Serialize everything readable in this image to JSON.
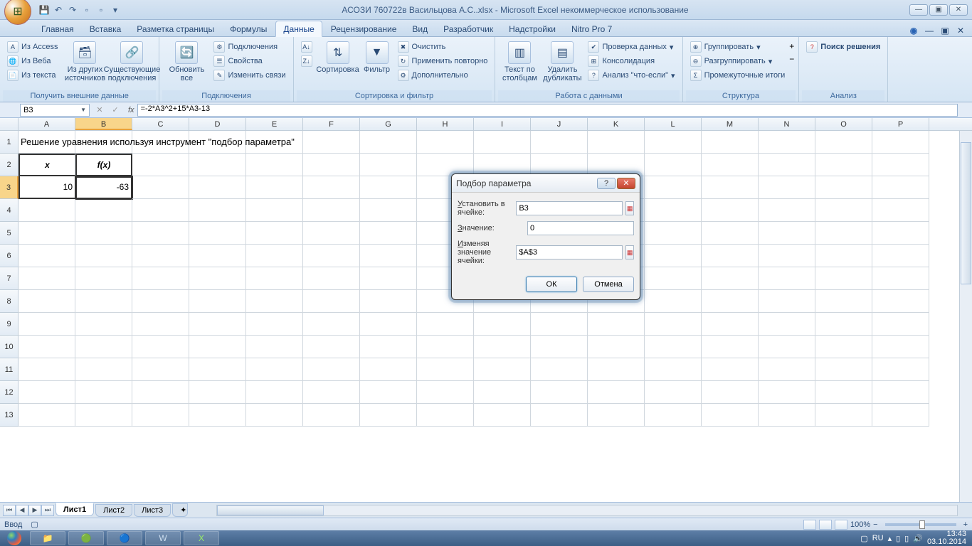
{
  "window": {
    "title": "АСОЗИ 760722в Васильцова А.С..xlsx - Microsoft Excel некоммерческое использование"
  },
  "tabs": {
    "items": [
      "Главная",
      "Вставка",
      "Разметка страницы",
      "Формулы",
      "Данные",
      "Рецензирование",
      "Вид",
      "Разработчик",
      "Надстройки",
      "Nitro Pro 7"
    ],
    "active_index": 4
  },
  "ribbon": {
    "g_ext": {
      "access": "Из Access",
      "web": "Из Веба",
      "text": "Из текста",
      "other": "Из других источников",
      "existing": "Существующие подключения",
      "label": "Получить внешние данные"
    },
    "g_conn": {
      "refresh": "Обновить все",
      "connections": "Подключения",
      "properties": "Свойства",
      "editlinks": "Изменить связи",
      "label": "Подключения"
    },
    "g_sort": {
      "sort": "Сортировка",
      "filter": "Фильтр",
      "clear": "Очистить",
      "reapply": "Применить повторно",
      "advanced": "Дополнительно",
      "label": "Сортировка и фильтр"
    },
    "g_data": {
      "ttc": "Текст по столбцам",
      "dup": "Удалить дубликаты",
      "valid": "Проверка данных",
      "consol": "Консолидация",
      "whatif": "Анализ \"что-если\"",
      "label": "Работа с данными"
    },
    "g_struct": {
      "group": "Группировать",
      "ungroup": "Разгруппировать",
      "subtotal": "Промежуточные итоги",
      "label": "Структура"
    },
    "g_analysis": {
      "solver": "Поиск решения",
      "label": "Анализ"
    }
  },
  "formula_bar": {
    "namebox": "B3",
    "fx": "fx",
    "formula": "=-2*A3^2+15*A3-13"
  },
  "grid": {
    "columns": [
      "A",
      "B",
      "C",
      "D",
      "E",
      "F",
      "G",
      "H",
      "I",
      "J",
      "K",
      "L",
      "M",
      "N",
      "O",
      "P"
    ],
    "row1_text": "Решение уравнения используя инструмент \"подбор параметра\"",
    "header_x": "x",
    "header_fx": "f(x)",
    "val_a3": "10",
    "val_b3": "-63"
  },
  "sheets": {
    "nav": [
      "⏮",
      "◀",
      "▶",
      "⏭"
    ],
    "items": [
      "Лист1",
      "Лист2",
      "Лист3"
    ],
    "active_index": 0
  },
  "statusbar": {
    "mode": "Ввод",
    "zoom": "100%"
  },
  "taskbar": {
    "lang": "RU",
    "time": "13:43",
    "date": "03.10.2014"
  },
  "dialog": {
    "title": "Подбор параметра",
    "set_cell_label": "Установить в ячейке:",
    "set_cell_value": "B3",
    "to_value_label": "Значение:",
    "to_value_value": "0",
    "by_changing_label": "Изменяя значение ячейки:",
    "by_changing_value": "$A$3",
    "ok": "ОК",
    "cancel": "Отмена"
  }
}
